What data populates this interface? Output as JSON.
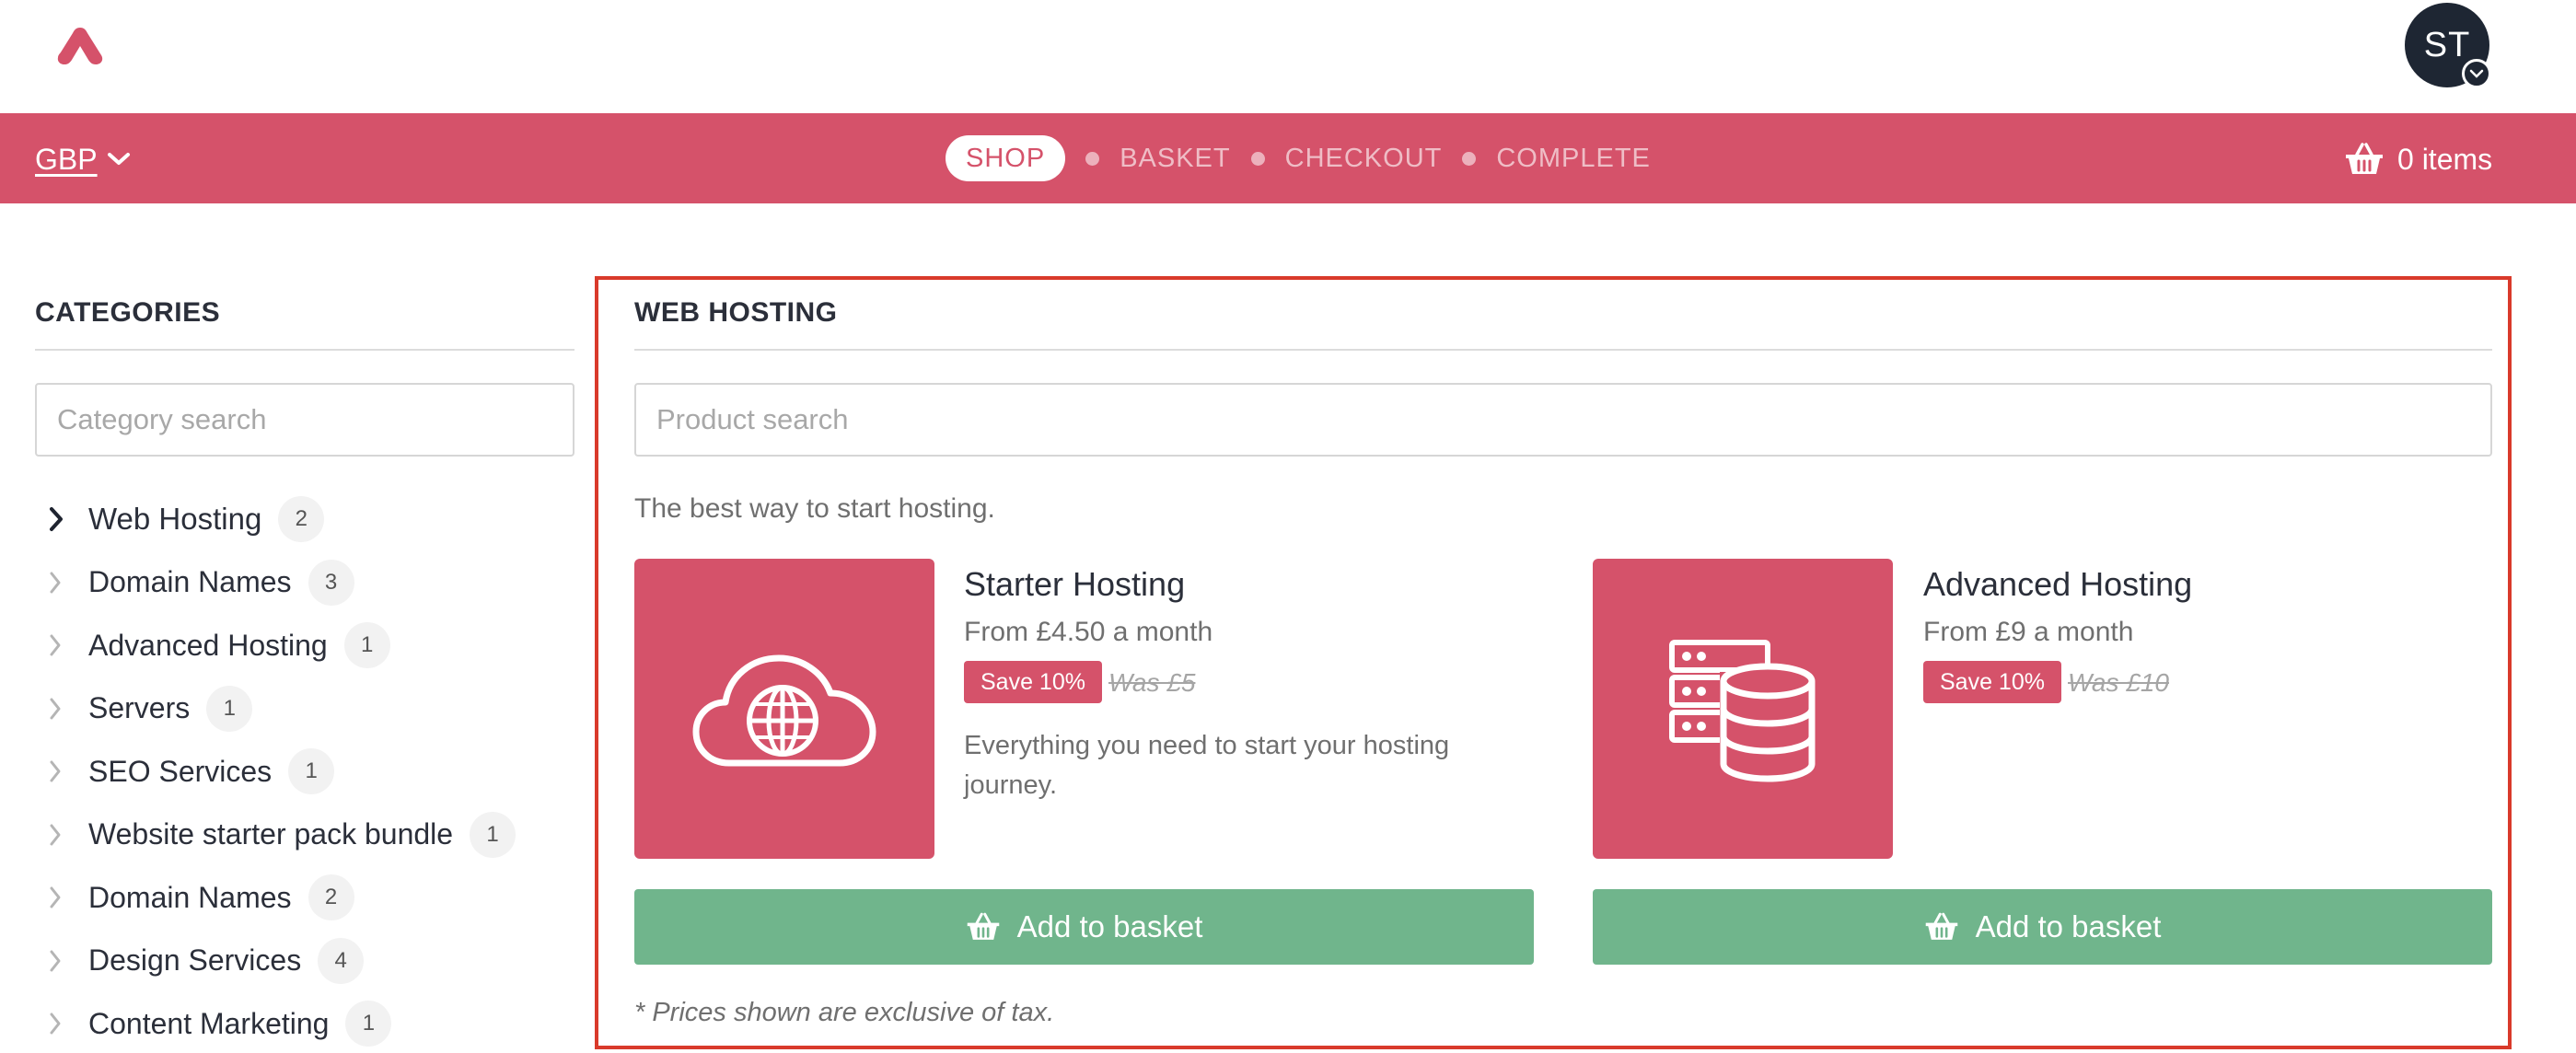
{
  "header": {
    "avatar_initials": "ST"
  },
  "navbar": {
    "currency": "GBP",
    "steps": {
      "active": "SHOP",
      "basket": "BASKET",
      "checkout": "CHECKOUT",
      "complete": "COMPLETE"
    },
    "basket_label": "0 items"
  },
  "sidebar": {
    "title": "CATEGORIES",
    "search_placeholder": "Category search",
    "items": [
      {
        "label": "Web Hosting",
        "count": "2"
      },
      {
        "label": "Domain Names",
        "count": "3"
      },
      {
        "label": "Advanced Hosting",
        "count": "1"
      },
      {
        "label": "Servers",
        "count": "1"
      },
      {
        "label": "SEO Services",
        "count": "1"
      },
      {
        "label": "Website starter pack bundle",
        "count": "1"
      },
      {
        "label": "Domain Names",
        "count": "2"
      },
      {
        "label": "Design Services",
        "count": "4"
      },
      {
        "label": "Content Marketing",
        "count": "1"
      }
    ]
  },
  "main": {
    "title": "WEB HOSTING",
    "search_placeholder": "Product search",
    "tagline": "The best way to start hosting.",
    "products": [
      {
        "name": "Starter Hosting",
        "price": "From £4.50 a month",
        "save": "Save 10%",
        "was": "Was £5",
        "description": "Everything you need to start your hosting journey.",
        "button": "Add to basket",
        "icon": "cloud-globe-icon"
      },
      {
        "name": "Advanced Hosting",
        "price": "From £9 a month",
        "save": "Save 10%",
        "was": "Was £10",
        "description": "",
        "button": "Add to basket",
        "icon": "server-database-icon"
      }
    ],
    "footnote": "* Prices shown are exclusive of tax."
  },
  "colors": {
    "brand": "#d5526a",
    "success": "#70b58c",
    "highlight_border": "#d93a2b",
    "avatar": "#1e2633"
  }
}
